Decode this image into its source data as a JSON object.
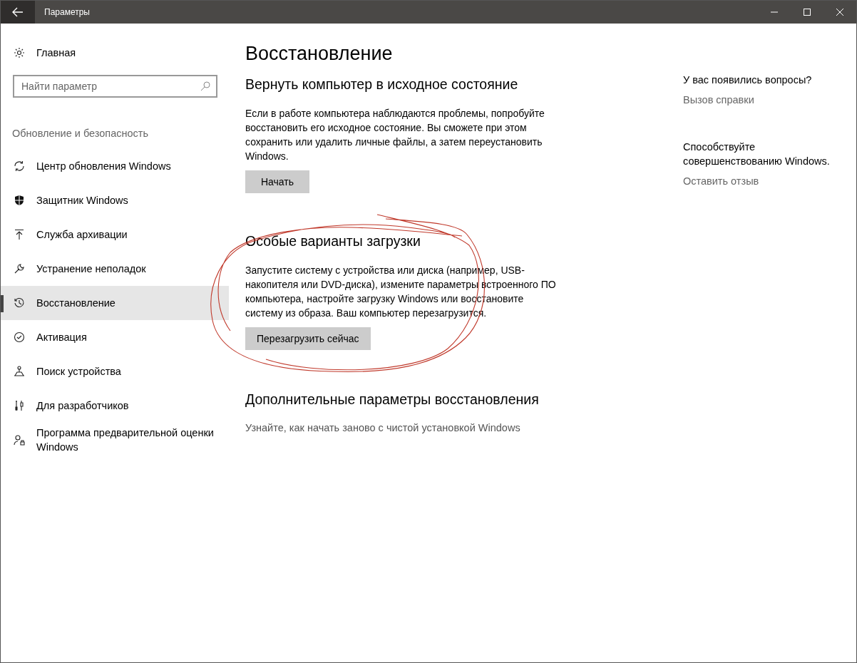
{
  "window": {
    "title": "Параметры"
  },
  "sidebar": {
    "home": "Главная",
    "search": {
      "placeholder": "Найти параметр"
    },
    "category": "Обновление и безопасность",
    "items": [
      {
        "label": "Центр обновления Windows",
        "selected": false
      },
      {
        "label": "Защитник Windows",
        "selected": false
      },
      {
        "label": "Служба архивации",
        "selected": false
      },
      {
        "label": "Устранение неполадок",
        "selected": false
      },
      {
        "label": "Восстановление",
        "selected": true
      },
      {
        "label": "Активация",
        "selected": false
      },
      {
        "label": "Поиск устройства",
        "selected": false
      },
      {
        "label": "Для разработчиков",
        "selected": false
      },
      {
        "label": "Программа предварительной оценки Windows",
        "selected": false
      }
    ]
  },
  "content": {
    "title": "Восстановление",
    "sections": [
      {
        "heading": "Вернуть компьютер в исходное состояние",
        "text": "Если в работе компьютера наблюдаются проблемы, попробуйте восстановить его исходное состояние. Вы сможете при этом сохранить или удалить личные файлы, а затем переустановить Windows.",
        "button": "Начать"
      },
      {
        "heading": "Особые варианты загрузки",
        "text": "Запустите систему с устройства или диска (например, USB-накопителя или DVD-диска), измените параметры встроенного ПО компьютера, настройте загрузку Windows или восстановите систему из образа. Ваш компьютер перезагрузится.",
        "button": "Перезагрузить сейчас"
      },
      {
        "heading": "Дополнительные параметры восстановления",
        "link": "Узнайте, как начать заново с чистой установкой Windows"
      }
    ]
  },
  "aside": [
    {
      "text": "У вас появились вопросы?",
      "link": "Вызов справки"
    },
    {
      "text": "Способствуйте совершенствованию Windows.",
      "link": "Оставить отзыв"
    }
  ]
}
